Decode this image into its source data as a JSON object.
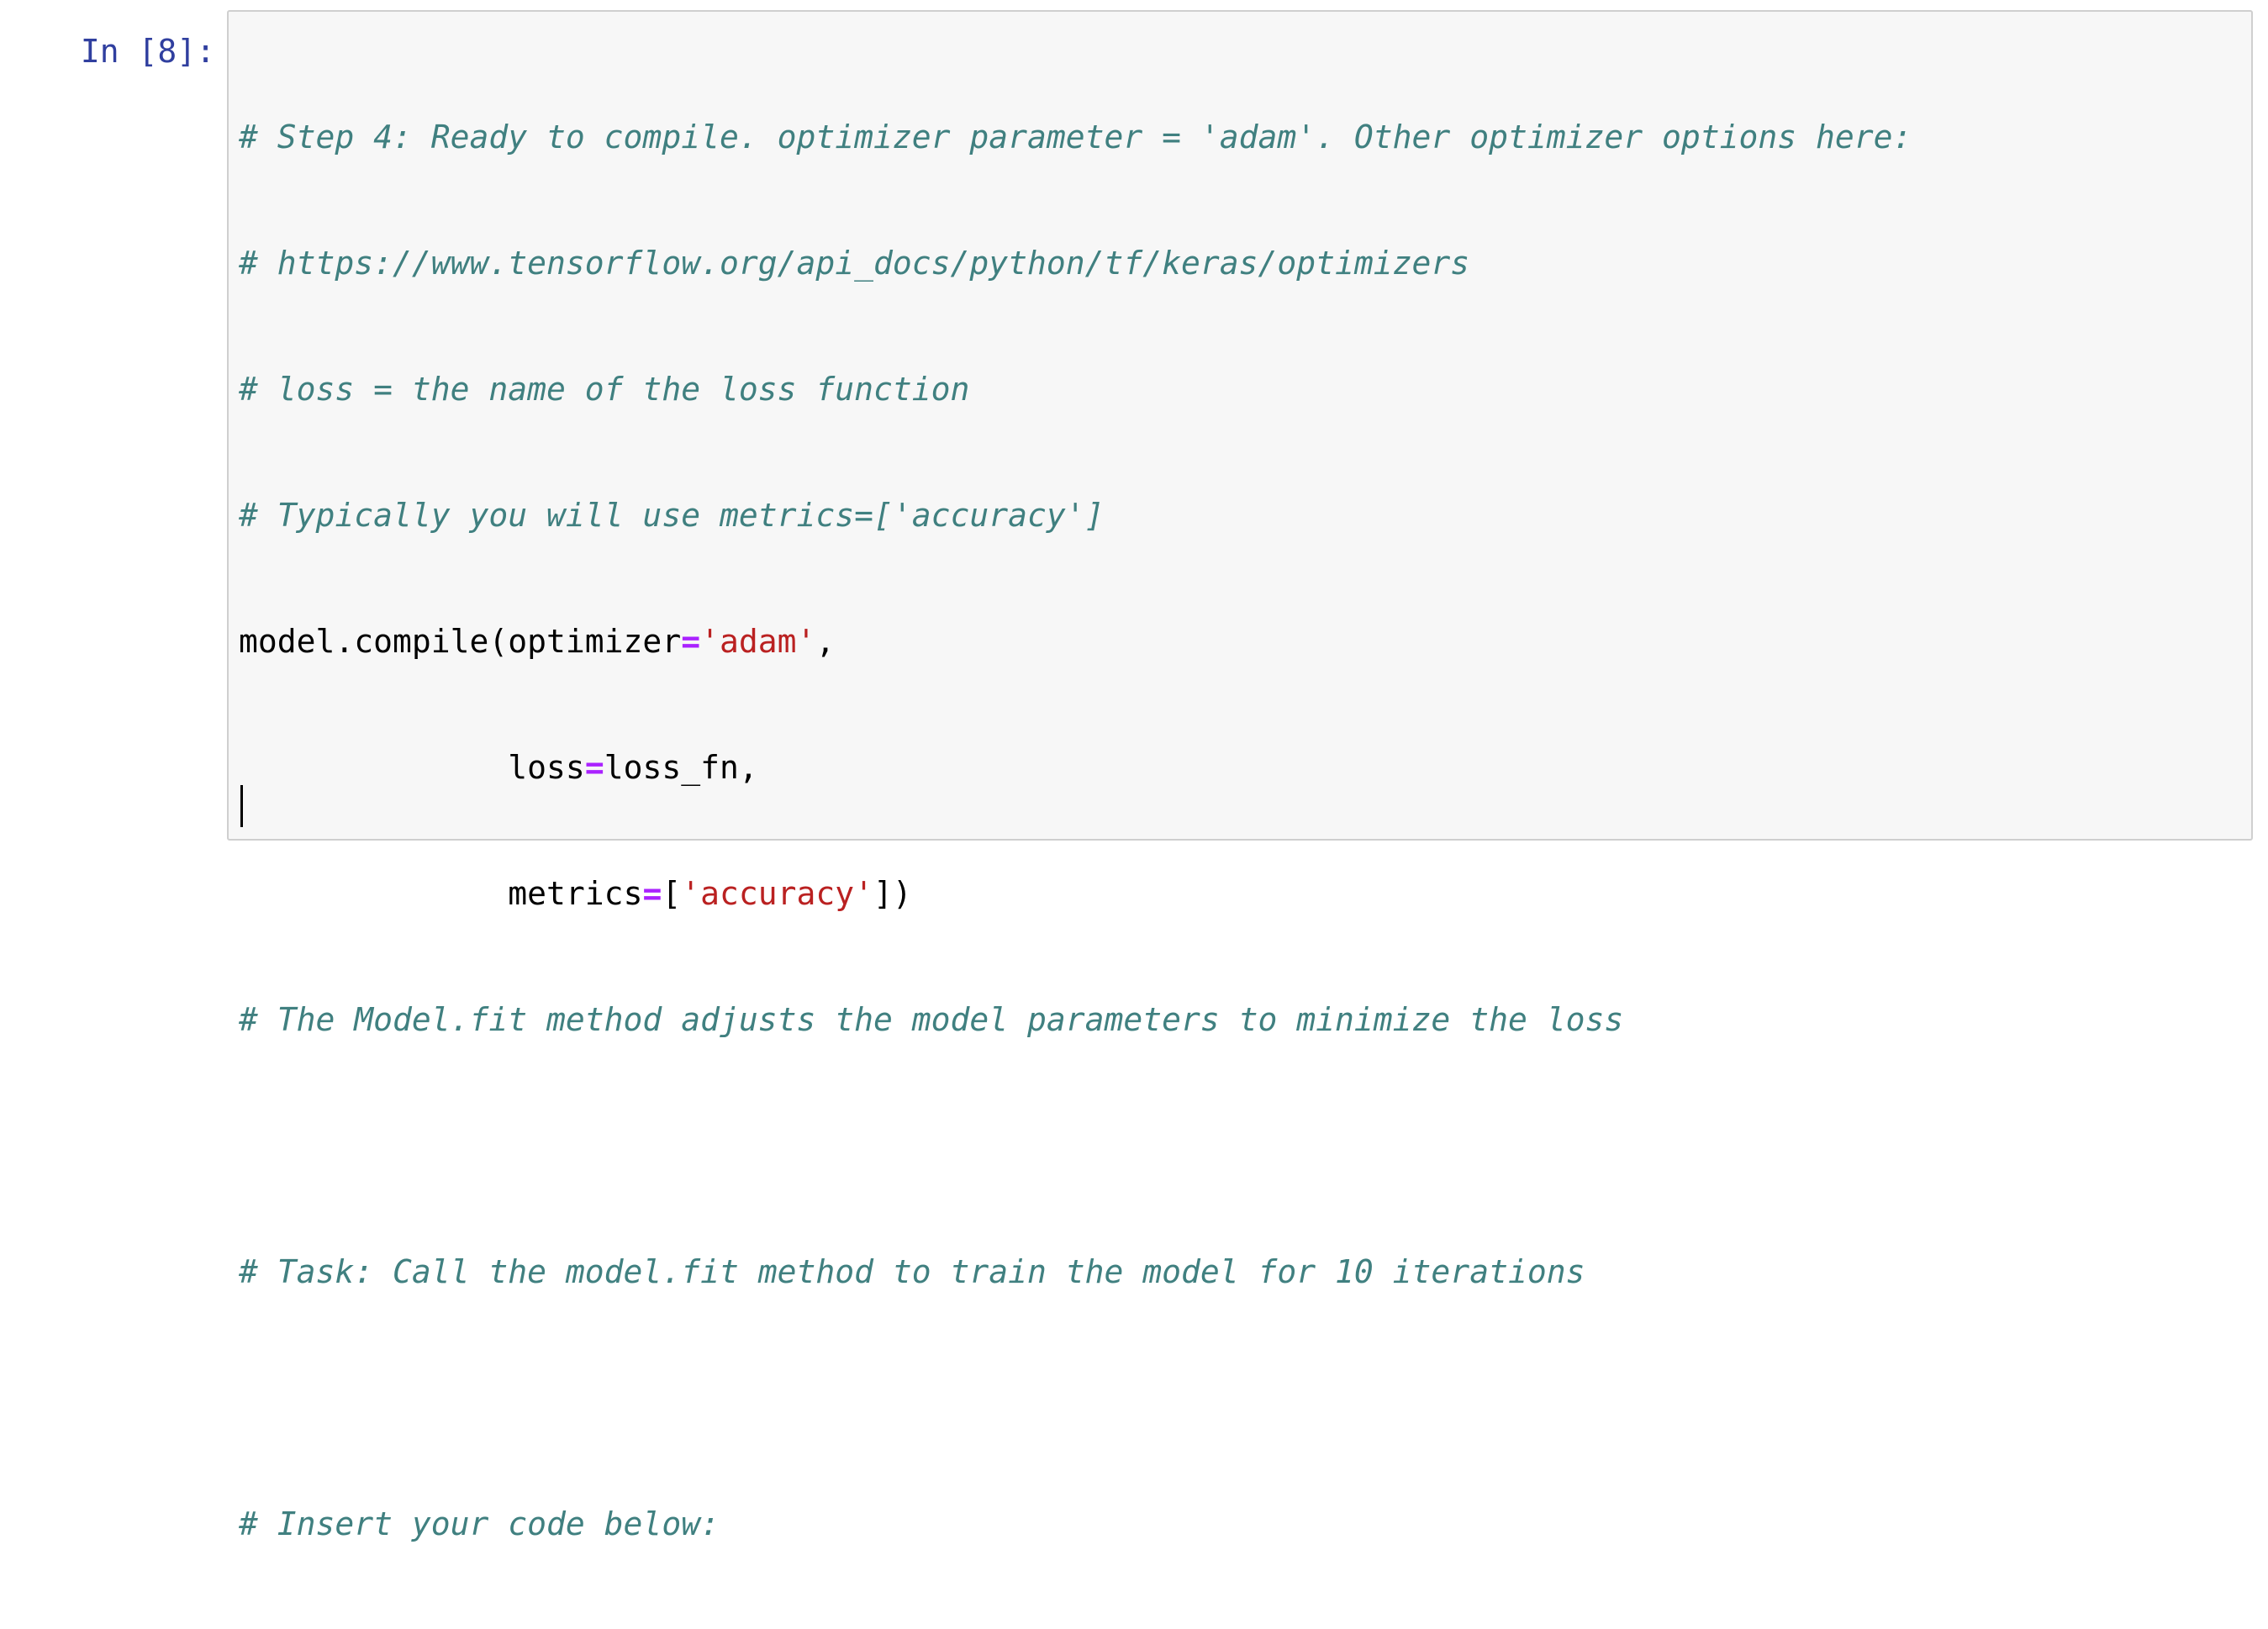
{
  "cell": {
    "prompt": "In [8]:",
    "comment1": "# Step 4: Ready to compile. optimizer parameter = 'adam'. Other optimizer options here:",
    "comment2": "# https://www.tensorflow.org/api_docs/python/tf/keras/optimizers",
    "comment3": "# loss = the name of the loss function",
    "comment4": "# Typically you will use metrics=['accuracy']",
    "line5": {
      "a": "model.compile(optimizer",
      "eq": "=",
      "str": "'adam'",
      "b": ","
    },
    "line6": {
      "indent": "              ",
      "a": "loss",
      "eq": "=",
      "b": "loss_fn,"
    },
    "line7": {
      "indent": "              ",
      "a": "metrics",
      "eq": "=",
      "b": "[",
      "str": "'accuracy'",
      "c": "])"
    },
    "comment8": "# The Model.fit method adjusts the model parameters to minimize the loss",
    "comment10": "# Task: Call the model.fit method to train the model for 10 iterations",
    "comment12": "# Insert your code below:"
  }
}
